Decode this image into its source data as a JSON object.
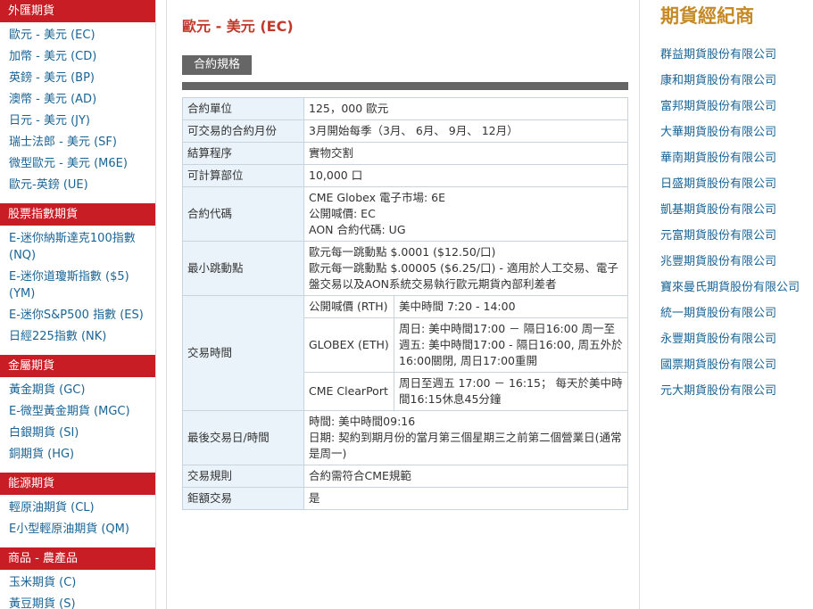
{
  "sidebar": {
    "categories": [
      {
        "title": "外匯期貨",
        "items": [
          "歐元 - 美元 (EC)",
          "加幣 - 美元 (CD)",
          "英鎊 - 美元 (BP)",
          "澳幣 - 美元 (AD)",
          "日元 - 美元 (JY)",
          "瑞士法郎 - 美元 (SF)",
          "微型歐元 - 美元 (M6E)",
          "歐元-英鎊 (UE)"
        ]
      },
      {
        "title": "股票指數期貨",
        "items": [
          "E-迷你納斯達克100指數 (NQ)",
          "E-迷你道瓊斯指數 ($5) (YM)",
          "E-迷你S&P500 指數 (ES)",
          "日經225指數 (NK)"
        ]
      },
      {
        "title": "金屬期貨",
        "items": [
          "黃金期貨 (GC)",
          "E-微型黃金期貨 (MGC)",
          "白銀期貨 (SI)",
          "銅期貨 (HG)"
        ]
      },
      {
        "title": "能源期貨",
        "items": [
          "輕原油期貨 (CL)",
          "E小型輕原油期貨 (QM)"
        ]
      },
      {
        "title": "商品 - 農產品",
        "items": [
          "玉米期貨 (C)",
          "黃豆期貨 (S)"
        ]
      }
    ]
  },
  "main": {
    "title": "歐元 - 美元 (EC)",
    "tab_label": "合約規格",
    "spec": {
      "unit_label": "合約單位",
      "unit_value": "125，000 歐元",
      "months_label": "可交易的合約月份",
      "months_value": "3月開始每季（3月、 6月、 9月、 12月）",
      "settle_label": "結算程序",
      "settle_value": "實物交割",
      "position_label": "可計算部位",
      "position_value": "10,000 口",
      "code_label": "合約代碼",
      "code_lines": [
        "CME Globex 電子市場: 6E",
        "公開喊價: EC",
        "AON 合約代碼: UG"
      ],
      "tick_label": "最小跳動點",
      "tick_lines": [
        "歐元每一跳動點 $.0001 ($12.50/口)",
        "歐元每一跳動點 $.00005 ($6.25/口) - 適用於人工交易、電子盤交易以及AON系統交易執行歐元期貨內部利差者"
      ],
      "hours_label": "交易時間",
      "hours": [
        {
          "name": "公開喊價 (RTH)",
          "value": "美中時間 7:20 - 14:00"
        },
        {
          "name": "GLOBEX (ETH)",
          "value": "周日: 美中時間17:00 － 隔日16:00 周一至週五: 美中時間17:00 - 隔日16:00, 周五外於16:00關閉, 周日17:00重開"
        },
        {
          "name": "CME ClearPort",
          "value": "周日至週五 17:00 － 16:15； 每天於美中時間16:15休息45分鐘"
        }
      ],
      "last_label": "最後交易日/時間",
      "last_lines": [
        "時間: 美中時間09:16",
        "日期: 契約到期月份的當月第三個星期三之前第二個營業日(通常是周一)"
      ],
      "rules_label": "交易規則",
      "rules_value": "合約需符合CME規範",
      "block_label": "鉅額交易",
      "block_value": "是"
    }
  },
  "brokers": {
    "title": "期貨經紀商",
    "items": [
      "群益期貨股份有限公司",
      "康和期貨股份有限公司",
      "富邦期貨股份有限公司",
      "大華期貨股份有限公司",
      "華南期貨股份有限公司",
      "日盛期貨股份有限公司",
      "凱基期貨股份有限公司",
      "元富期貨股份有限公司",
      "兆豐期貨股份有限公司",
      "寶來曼氏期貨股份有限公司",
      "統一期貨股份有限公司",
      "永豐期貨股份有限公司",
      "國票期貨股份有限公司",
      "元大期貨股份有限公司"
    ]
  }
}
